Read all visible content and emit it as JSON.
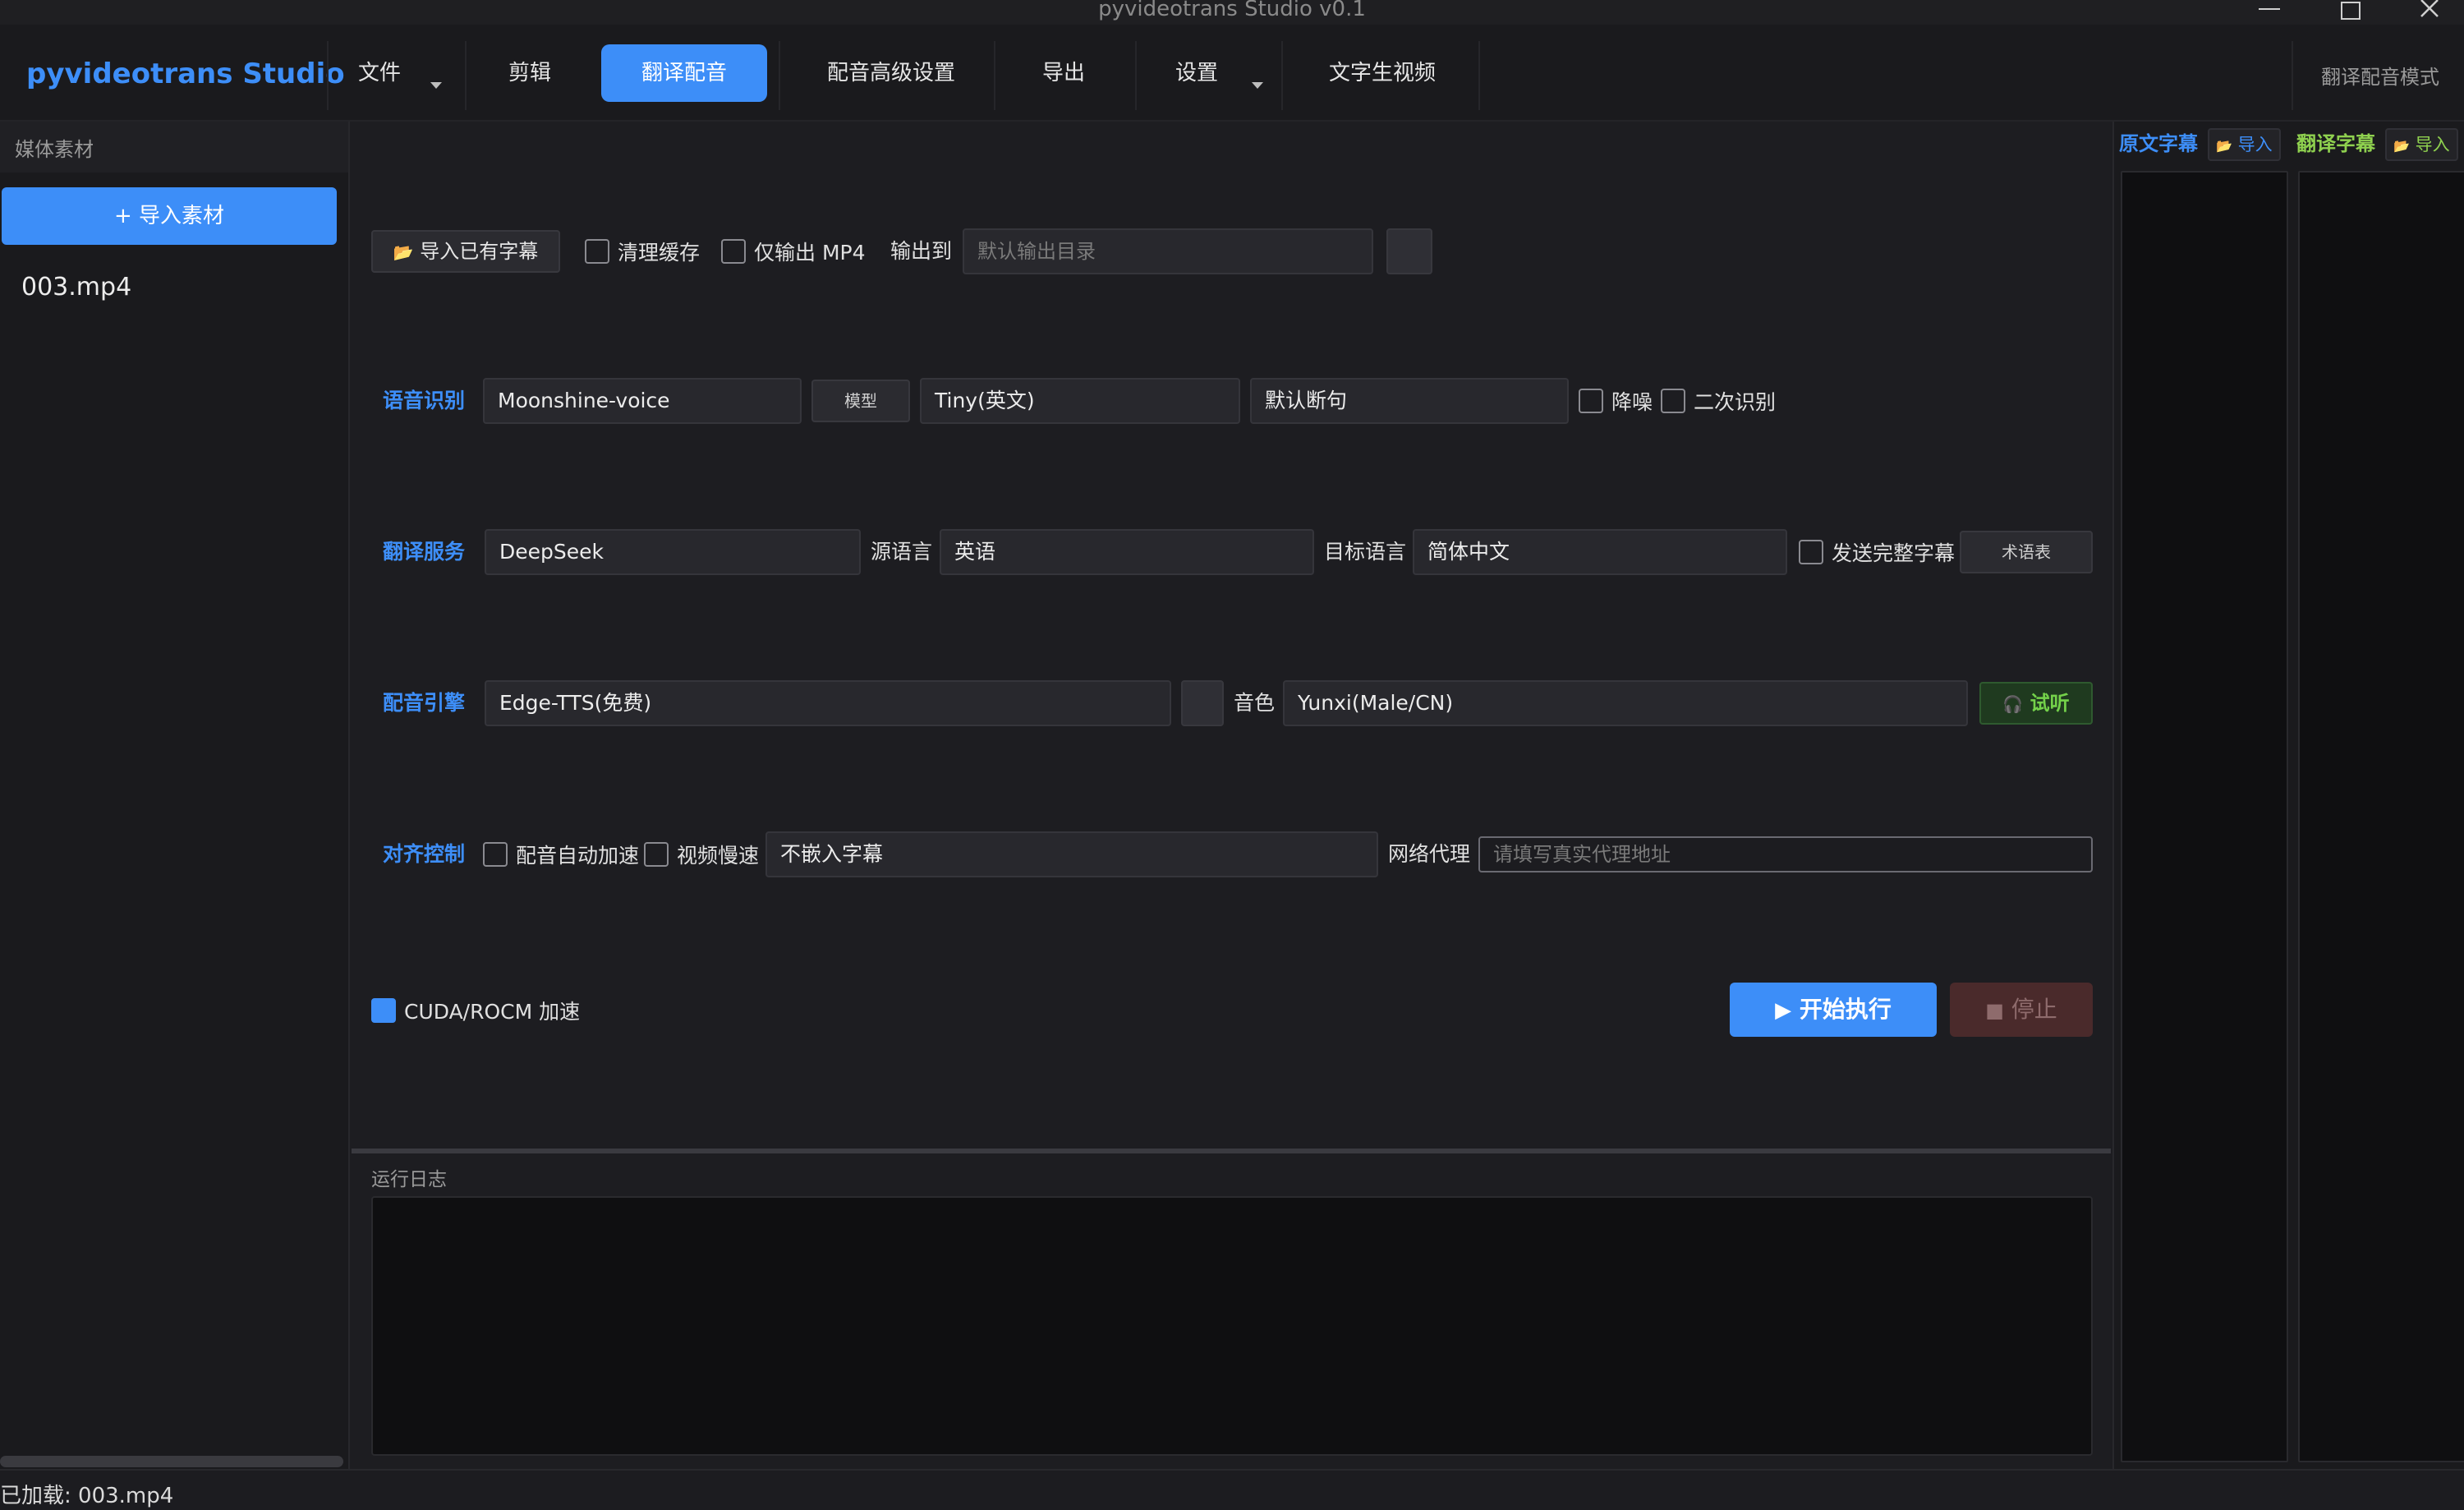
{
  "window": {
    "title": "pyvideotrans Studio v0.1"
  },
  "menubar": {
    "brand": "pyvideotrans Studio",
    "items": [
      {
        "label": "文件",
        "dropdown": true
      },
      {
        "label": "剪辑"
      },
      {
        "label": "翻译配音",
        "active": true
      },
      {
        "label": "配音高级设置"
      },
      {
        "label": "导出"
      },
      {
        "label": "设置",
        "dropdown": true
      },
      {
        "label": "文字生视频"
      }
    ],
    "mode_label": "翻译配音模式"
  },
  "sidebar": {
    "header": "媒体素材",
    "import_button": "+ 导入素材",
    "files": [
      "003.mp4"
    ]
  },
  "output_row": {
    "import_subtitle_button": "导入已有字幕",
    "clear_cache": {
      "label": "清理缓存",
      "checked": false
    },
    "mp4_only": {
      "label": "仅输出 MP4",
      "checked": false
    },
    "output_label": "输出到",
    "output_placeholder": "默认输出目录"
  },
  "speech_recognition": {
    "section_label": "语音识别",
    "engine": "Moonshine-voice",
    "model_button": "模型",
    "model": "Tiny(英文)",
    "segmentation": "默认断句",
    "denoise": {
      "label": "降噪",
      "checked": false
    },
    "second_pass": {
      "label": "二次识别",
      "checked": false
    }
  },
  "translation": {
    "section_label": "翻译服务",
    "service": "DeepSeek",
    "source_label": "源语言",
    "source_language": "英语",
    "target_label": "目标语言",
    "target_language": "简体中文",
    "send_full_subtitle": {
      "label": "发送完整字幕",
      "checked": false
    },
    "glossary_button": "术语表"
  },
  "dubbing": {
    "section_label": "配音引擎",
    "engine": "Edge-TTS(免费)",
    "voice_label": "音色",
    "voice": "Yunxi(Male/CN)",
    "listen_button": "试听"
  },
  "alignment": {
    "section_label": "对齐控制",
    "auto_speedup": {
      "label": "配音自动加速",
      "checked": false
    },
    "video_slowdown": {
      "label": "视频慢速",
      "checked": false
    },
    "subtitle_embed": "不嵌入字幕",
    "proxy_label": "网络代理",
    "proxy_placeholder": "请填写真实代理地址"
  },
  "acceleration": {
    "label": "CUDA/ROCM 加速",
    "checked": true
  },
  "actions": {
    "start": "开始执行",
    "stop": "停止"
  },
  "log": {
    "title": "运行日志"
  },
  "subtitle_panel": {
    "original_title": "原文字幕",
    "original_import": "导入",
    "translated_title": "翻译字幕",
    "translated_import": "导入"
  },
  "statusbar": {
    "text": "已加载: 003.mp4"
  },
  "colors": {
    "accent": "#3d8ef8",
    "listen_green": "#74d24a",
    "translated_title_green": "#8fd14f",
    "stop_red": "#4a2a2b"
  }
}
